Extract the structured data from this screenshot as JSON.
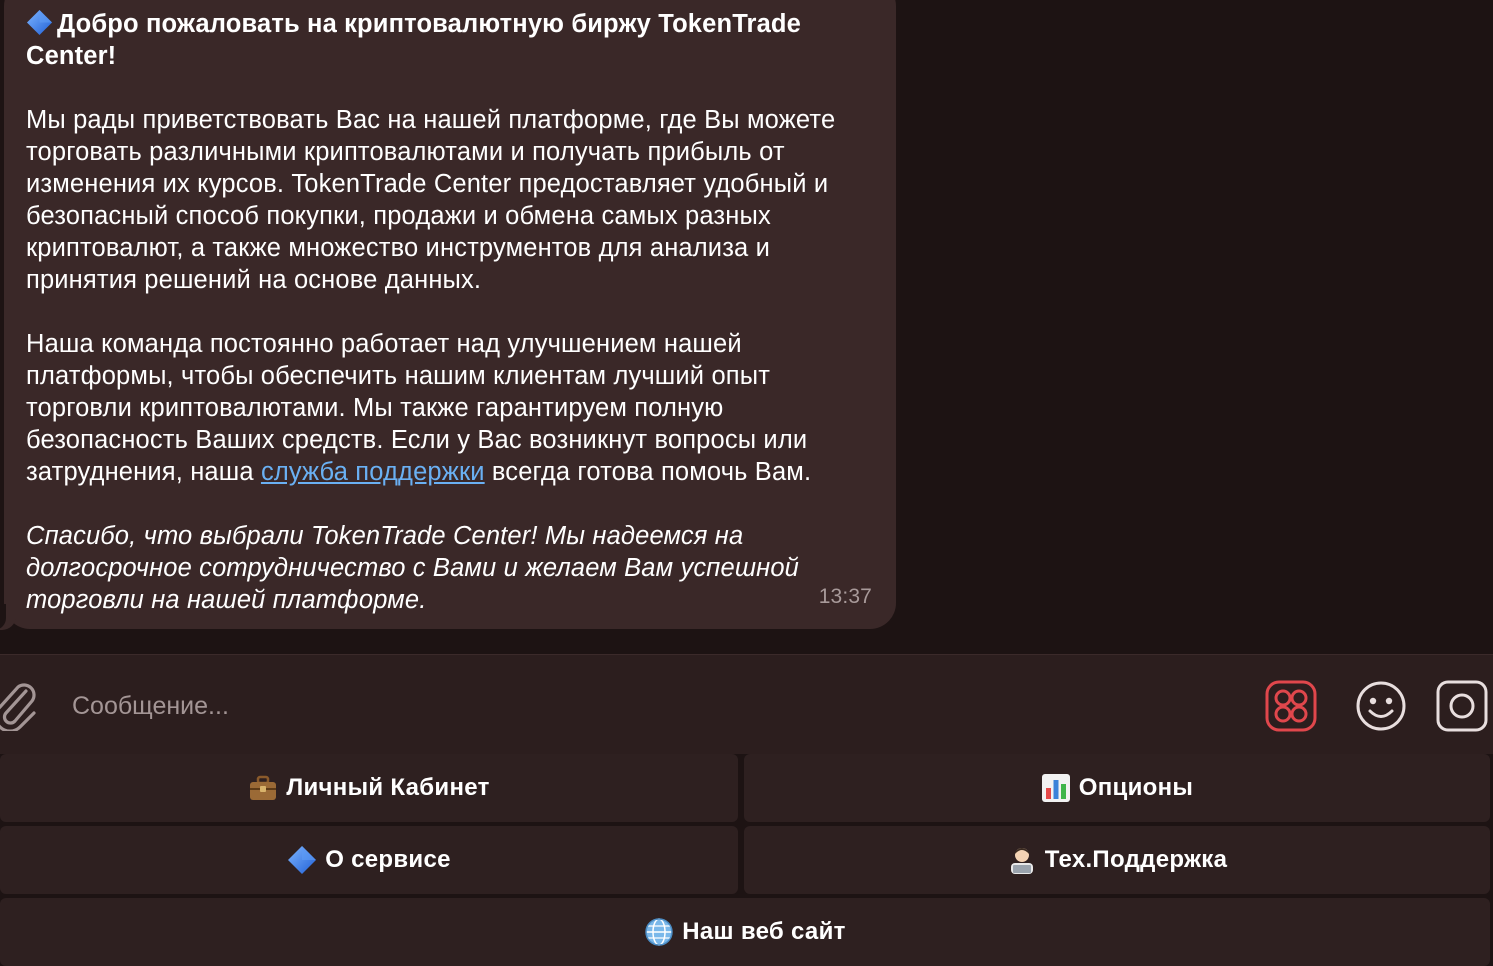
{
  "message": {
    "title": "Добро пожаловать на криптовалютную биржу TokenTrade Center!",
    "paragraph1": "Мы рады приветствовать Вас на нашей платформе, где Вы можете торговать различными криптовалютами и получать прибыль от изменения их курсов. TokenTrade Center предоставляет удобный и безопасный способ покупки, продажи и обмена самых разных криптовалют, а также множество инструментов для анализа и принятия решений на основе данных.",
    "paragraph2_before_link": "Наша команда постоянно работает над улучшением нашей платформы, чтобы обеспечить нашим клиентам лучший опыт торговли криптовалютами. Мы также гарантируем полную безопасность Ваших средств. Если у Вас возникнут вопросы или затруднения, наша ",
    "paragraph2_link": "служба поддержки",
    "paragraph2_after_link": " всегда готова помочь Вам.",
    "closing": "Спасибо, что выбрали TokenTrade Center! Мы надеемся на долгосрочное сотрудничество с Вами и желаем Вам успешной торговли на нашей платформе.",
    "time": "13:37"
  },
  "input": {
    "placeholder": "Сообщение..."
  },
  "keyboard": {
    "personal_cabinet": "Личный Кабинет",
    "options": "Опционы",
    "about_service": "О сервисе",
    "tech_support": "Тех.Поддержка",
    "website": "Наш веб сайт"
  },
  "colors": {
    "background": "#1d1313",
    "bubble": "#3a2828",
    "link": "#6ab0f3",
    "accent_red": "#e0474c"
  },
  "icons": {
    "attach": "paperclip-icon",
    "bot_menu": "app-grid-icon",
    "emoji": "smiley-icon",
    "camera": "camera-icon"
  }
}
